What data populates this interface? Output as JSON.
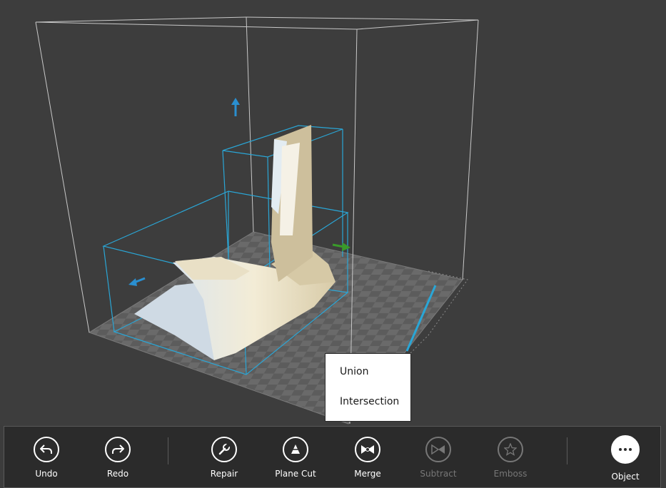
{
  "context_menu": {
    "items": [
      {
        "label": "Union"
      },
      {
        "label": "Intersection"
      }
    ]
  },
  "toolbar": {
    "undo": {
      "label": "Undo",
      "icon": "undo-icon"
    },
    "redo": {
      "label": "Redo",
      "icon": "redo-icon"
    },
    "repair": {
      "label": "Repair",
      "icon": "wrench-icon"
    },
    "plane_cut": {
      "label": "Plane Cut",
      "icon": "plane-cut-icon"
    },
    "merge": {
      "label": "Merge",
      "icon": "merge-icon"
    },
    "subtract": {
      "label": "Subtract",
      "icon": "subtract-icon",
      "disabled": true
    },
    "emboss": {
      "label": "Emboss",
      "icon": "star-icon",
      "disabled": true
    },
    "object": {
      "label": "Object",
      "icon": "more-icon"
    }
  },
  "colors": {
    "background": "#3d3d3d",
    "selection_box": "#2aa6d6",
    "model": "#f1ead6",
    "arrow_x": "#3a9a2a",
    "arrow_y": "#2a8fd0"
  }
}
